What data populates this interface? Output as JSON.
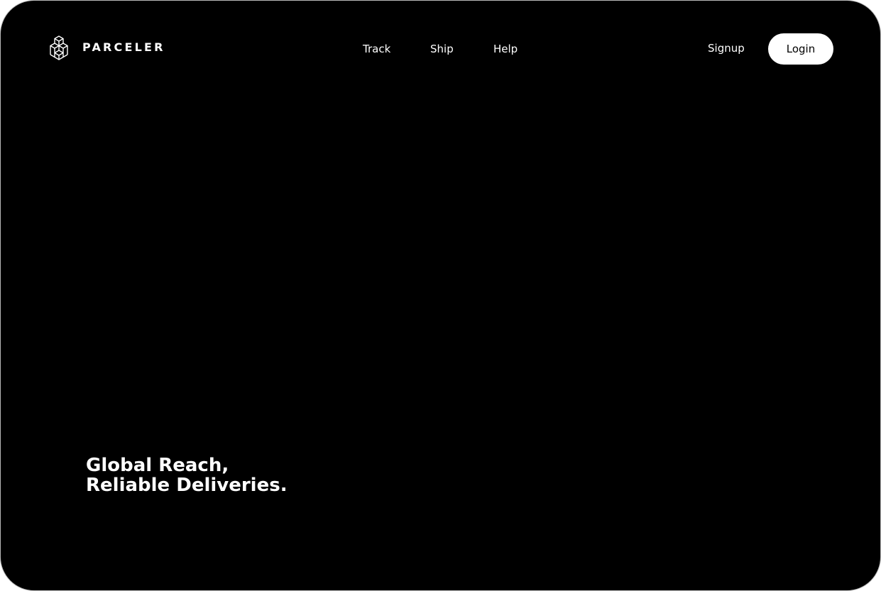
{
  "header": {
    "brand_name": "PARCELER",
    "logo_icon": "stacked-boxes-icon",
    "nav": [
      {
        "label": "Track"
      },
      {
        "label": "Ship"
      },
      {
        "label": "Help"
      }
    ],
    "signup_label": "Signup",
    "login_label": "Login"
  },
  "hero": {
    "headline_line1": "Global Reach,",
    "headline_line2": "Reliable Deliveries."
  },
  "colors": {
    "background": "#000000",
    "text": "#ffffff",
    "login_button_bg": "#ffffff",
    "login_button_text": "#000000"
  }
}
